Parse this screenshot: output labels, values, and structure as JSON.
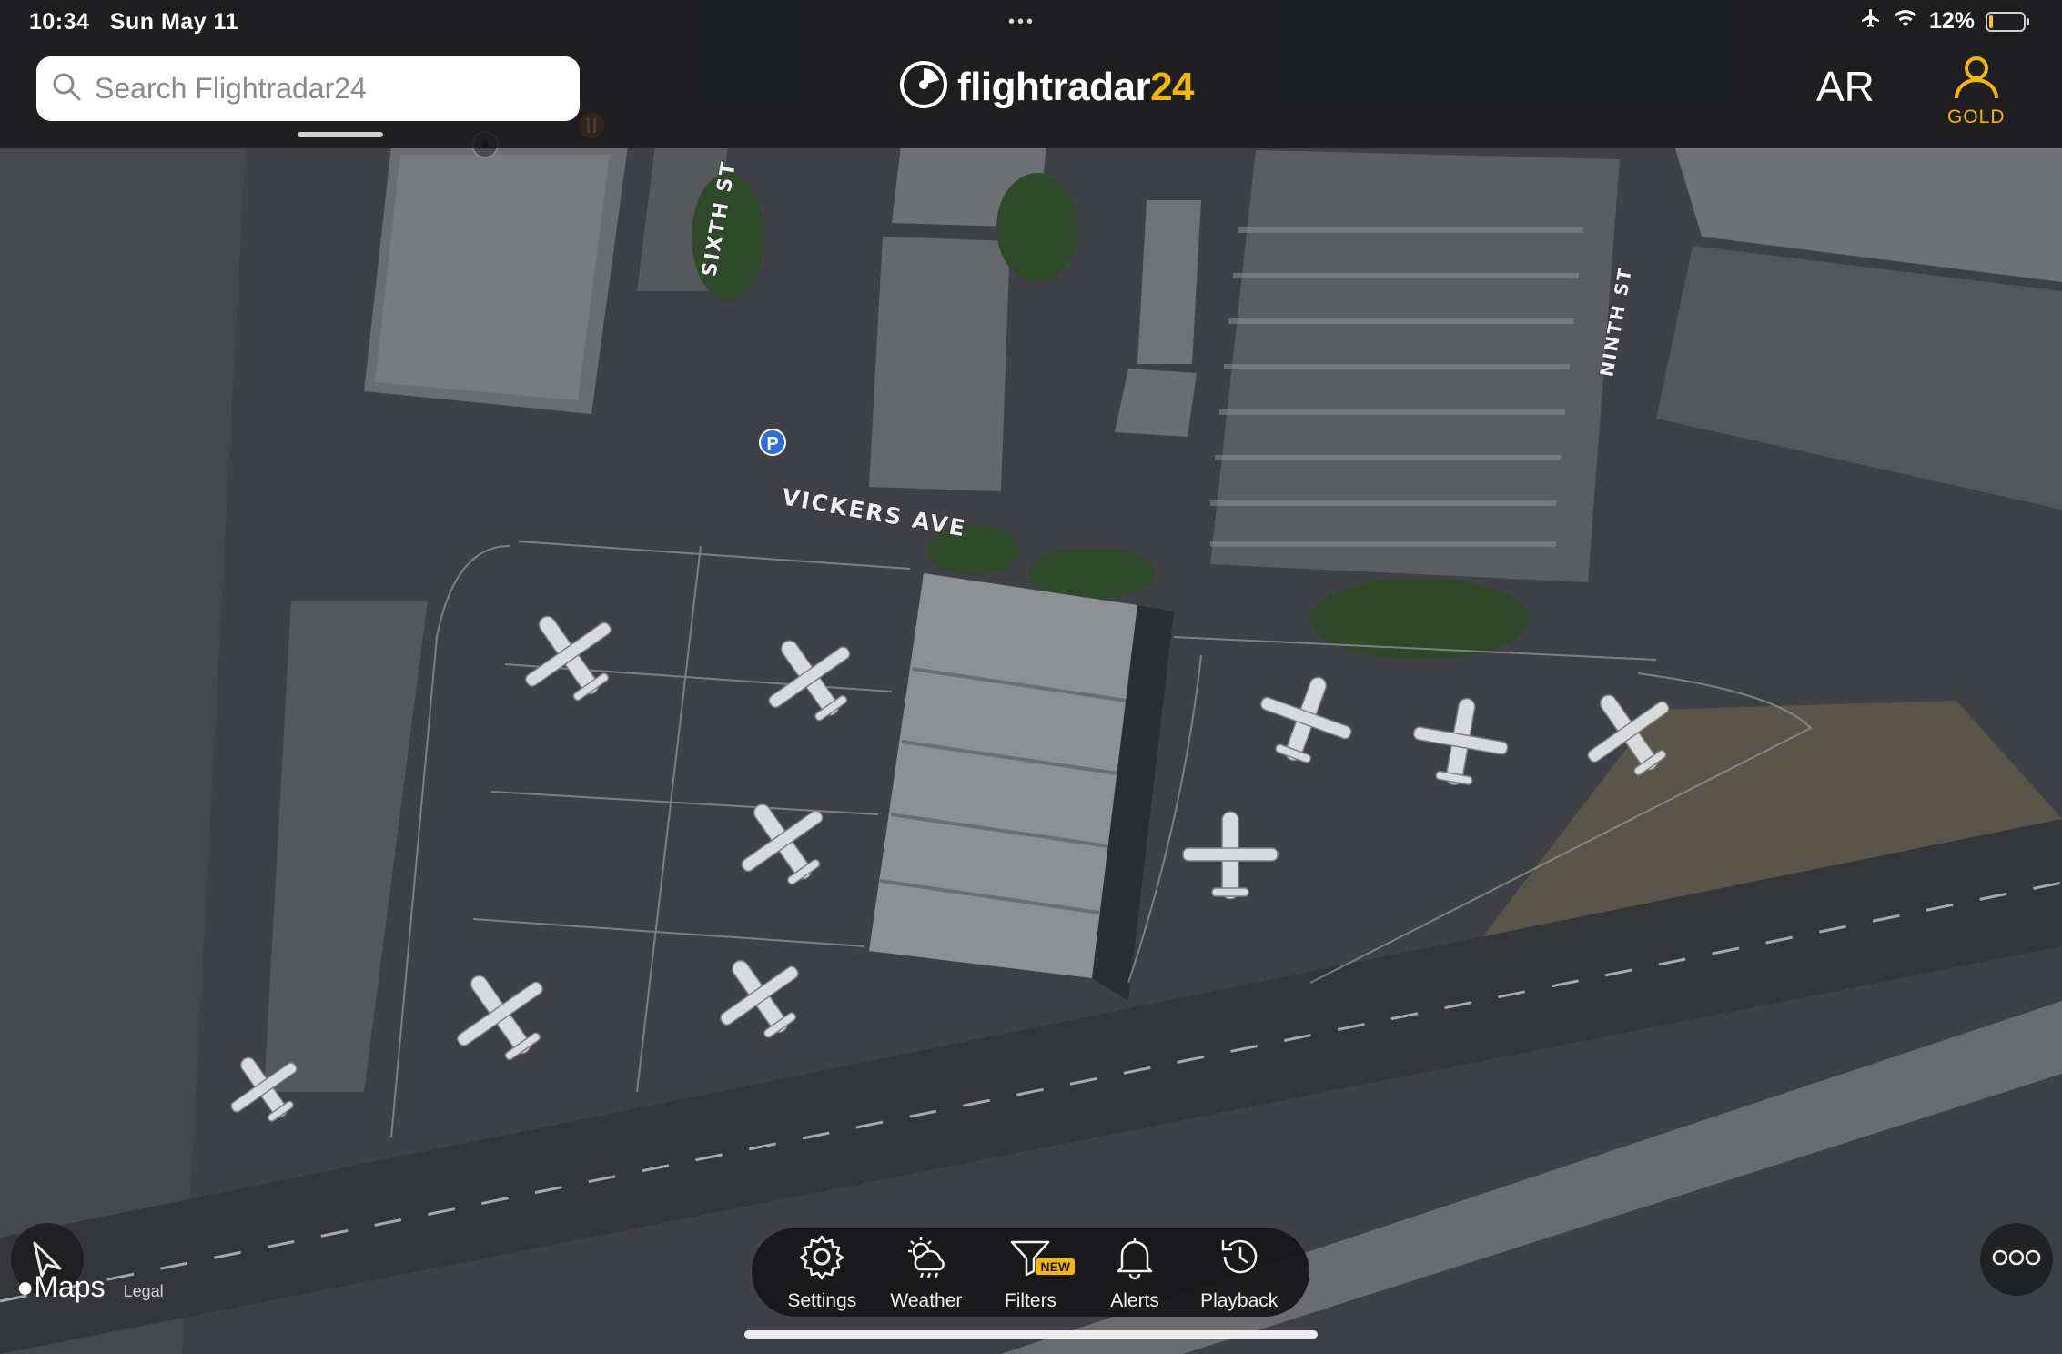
{
  "status_bar": {
    "time": "10:34",
    "date": "Sun May 11",
    "battery": "12%",
    "battery_level": 0.12,
    "icons": [
      "airplane-mode-icon",
      "wifi-icon",
      "battery-icon"
    ]
  },
  "search": {
    "placeholder": "Search Flightradar24"
  },
  "brand": {
    "name": "flightradar",
    "number": "24"
  },
  "header_actions": {
    "ar_label": "AR",
    "gold_label": "GOLD"
  },
  "map": {
    "street_labels": [
      "SIXTH ST",
      "VICKERS AVE",
      "NINTH ST"
    ],
    "poi_icons": [
      "parking-icon",
      "restaurant-icon",
      "poi-icon"
    ],
    "attribution": "Maps",
    "legal": "Legal"
  },
  "toolbar": {
    "items": [
      {
        "label": "Settings",
        "icon": "gear-icon"
      },
      {
        "label": "Weather",
        "icon": "weather-icon"
      },
      {
        "label": "Filters",
        "icon": "filter-icon",
        "badge": "NEW"
      },
      {
        "label": "Alerts",
        "icon": "bell-icon"
      },
      {
        "label": "Playback",
        "icon": "history-icon"
      }
    ]
  },
  "colors": {
    "accent_gold": "#f5b800",
    "bar_dark": "#18181a",
    "map_tarmac": "#45474c"
  }
}
